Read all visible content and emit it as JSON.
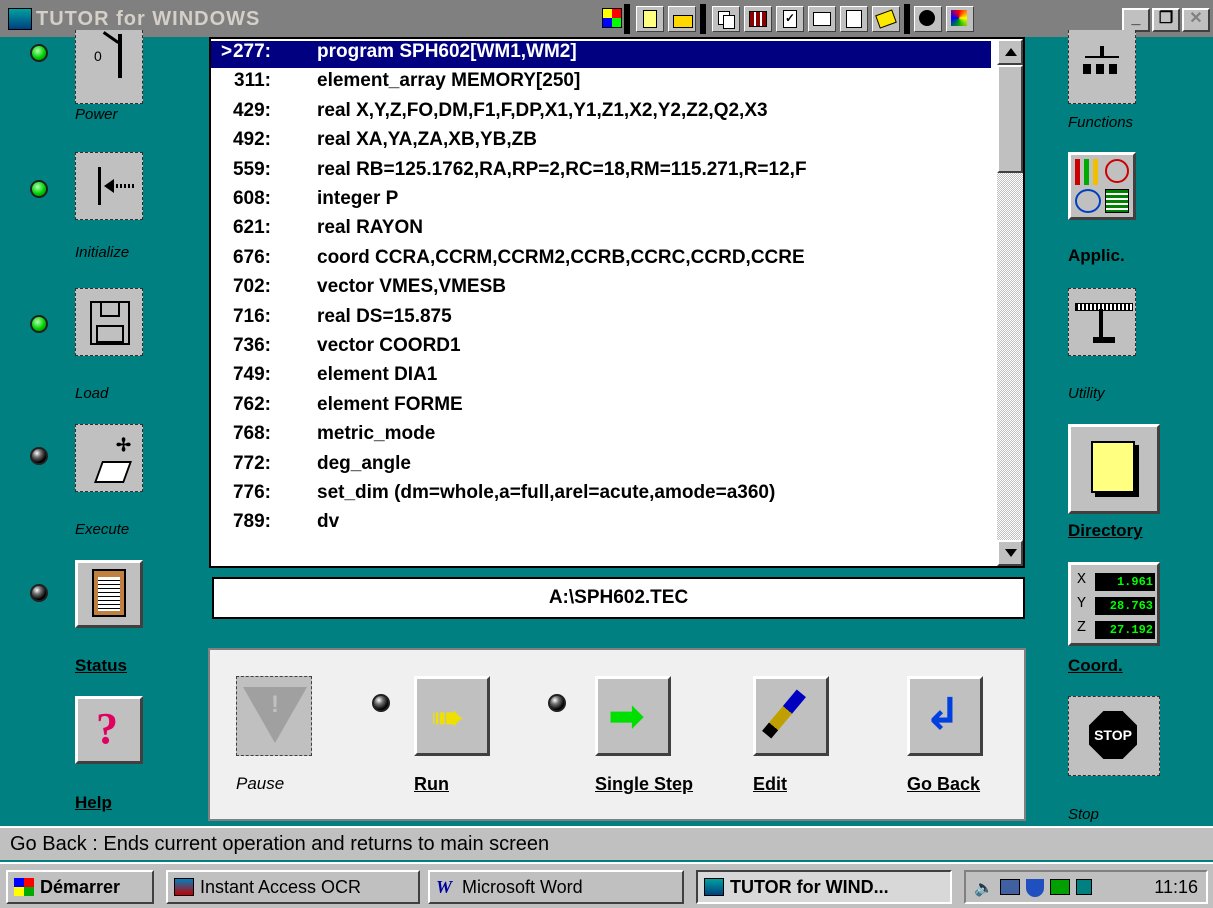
{
  "app": {
    "title": "TUTOR for WINDOWS"
  },
  "left_commands": [
    {
      "label": "Power",
      "led": "on"
    },
    {
      "label": "Initialize",
      "led": "on"
    },
    {
      "label": "Load",
      "led": "on"
    },
    {
      "label": "Execute",
      "led": "off"
    },
    {
      "label": "Status",
      "led": "off"
    },
    {
      "label": "Help"
    }
  ],
  "listing": {
    "lines": [
      {
        "marker": ">",
        "num": "277:",
        "code": "program SPH602[WM1,WM2]",
        "selected": true
      },
      {
        "num": "311:",
        "code": "element_array MEMORY[250]"
      },
      {
        "num": "429:",
        "code": "real X,Y,Z,FO,DM,F1,F,DP,X1,Y1,Z1,X2,Y2,Z2,Q2,X3"
      },
      {
        "num": "492:",
        "code": "real XA,YA,ZA,XB,YB,ZB"
      },
      {
        "num": "559:",
        "code": "real RB=125.1762,RA,RP=2,RC=18,RM=115.271,R=12,F"
      },
      {
        "num": "608:",
        "code": "integer P"
      },
      {
        "num": "621:",
        "code": "real RAYON"
      },
      {
        "num": "676:",
        "code": "coord CCRA,CCRM,CCRM2,CCRB,CCRC,CCRD,CCRE"
      },
      {
        "num": "702:",
        "code": "vector VMES,VMESB"
      },
      {
        "num": "716:",
        "code": "real DS=15.875"
      },
      {
        "num": "736:",
        "code": "vector COORD1"
      },
      {
        "num": "749:",
        "code": "element DIA1"
      },
      {
        "num": "762:",
        "code": "element FORME"
      },
      {
        "num": "768:",
        "code": "metric_mode"
      },
      {
        "num": "772:",
        "code": "deg_angle"
      },
      {
        "num": "776:",
        "code": "set_dim (dm=whole,a=full,arel=acute,amode=a360)"
      },
      {
        "num": "789:",
        "code": "dv"
      }
    ]
  },
  "file_path": "A:\\SPH602.TEC",
  "right_commands": [
    {
      "label": "Functions"
    },
    {
      "label": "Applic."
    },
    {
      "label": "Utility"
    },
    {
      "label": "Directory"
    },
    {
      "label": "Coord."
    },
    {
      "label": "Stop"
    }
  ],
  "coord": {
    "x": "1.961",
    "y": "28.763",
    "z": "27.192"
  },
  "controls": {
    "pause": "Pause",
    "run": "Run",
    "single_step": "Single Step",
    "edit": "Edit",
    "go_back": "Go Back"
  },
  "status_text": "Go Back : Ends current operation and returns to main screen",
  "taskbar": {
    "start": "Démarrer",
    "tasks": [
      "Instant Access OCR",
      "Microsoft Word",
      "TUTOR for WIND..."
    ],
    "clock": "11:16"
  },
  "colors": {
    "desktop": "#008080",
    "selection": "#000080",
    "led_on": "#00d000"
  }
}
